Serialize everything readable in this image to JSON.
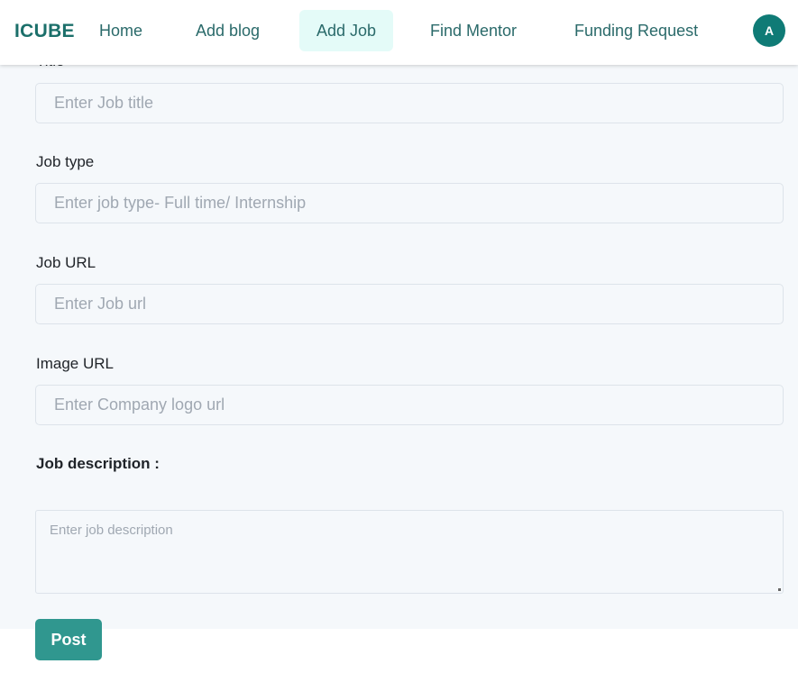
{
  "navbar": {
    "brand": "ICUBE",
    "items": [
      {
        "label": "Home"
      },
      {
        "label": "Add blog"
      },
      {
        "label": "Add Job"
      },
      {
        "label": "Find Mentor"
      },
      {
        "label": "Funding Request"
      }
    ],
    "active_item": "Add Job",
    "avatar_initial": "A"
  },
  "form": {
    "title_label": "Title",
    "title_placeholder": "Enter Job title",
    "job_type_label": "Job type",
    "job_type_placeholder": "Enter job type- Full time/ Internship",
    "job_url_label": "Job URL",
    "job_url_placeholder": "Enter Job url",
    "image_url_label": "Image URL",
    "image_url_placeholder": "Enter Company logo url",
    "description_label": "Job description :",
    "description_placeholder": "Enter job description",
    "submit_label": "Post"
  },
  "colors": {
    "brand": "#1b6f6a",
    "accent": "#30978f",
    "active_nav_bg": "#e4fbf8",
    "form_bg": "#f5f8fb"
  }
}
